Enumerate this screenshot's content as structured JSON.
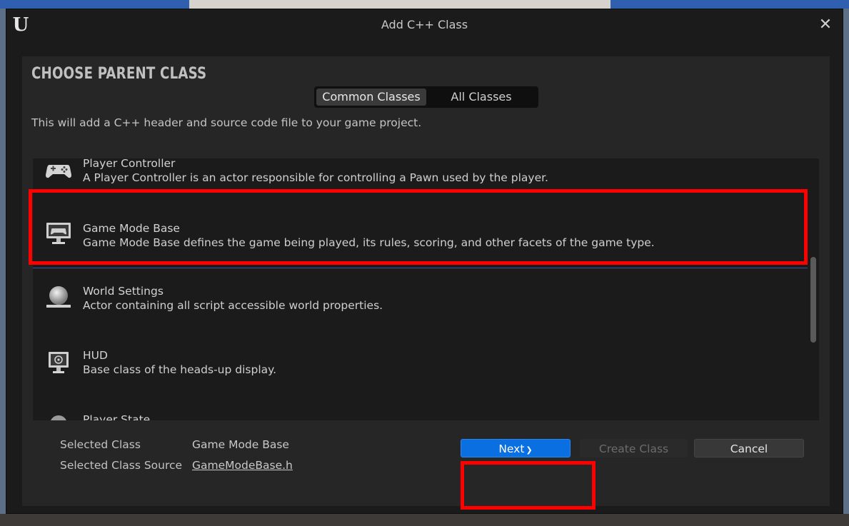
{
  "dialog": {
    "title": "Add C++ Class",
    "logo_text": "U",
    "close_glyph": "✕"
  },
  "panel": {
    "heading": "CHOOSE PARENT CLASS",
    "tabs": [
      {
        "label": "Common Classes",
        "active": true
      },
      {
        "label": "All Classes",
        "active": false
      }
    ],
    "description": "This will add a C++ header and source code file to your game project."
  },
  "class_list": {
    "items": [
      {
        "name": "Player Controller",
        "description": "A Player Controller is an actor responsible for controlling a Pawn used by the player.",
        "icon": "gamepad-icon"
      },
      {
        "name": "Game Mode Base",
        "description": "Game Mode Base defines the game being played, its rules, scoring, and other facets of the game type.",
        "icon": "monitor-gamepad-icon",
        "selected": true
      },
      {
        "name": "World Settings",
        "description": "Actor containing all script accessible world properties.",
        "icon": "sphere-icon"
      },
      {
        "name": "HUD",
        "description": "Base class of the heads-up display.",
        "icon": "monitor-target-icon"
      },
      {
        "name": "Player State",
        "description": "",
        "icon": "sphere-icon"
      }
    ]
  },
  "selection": {
    "class_label": "Selected Class",
    "class_value": "Game Mode Base",
    "source_label": "Selected Class Source",
    "source_value": "GameModeBase.h"
  },
  "buttons": {
    "next": "Next",
    "next_glyph": "❯",
    "create": "Create Class",
    "cancel": "Cancel"
  },
  "colors": {
    "primary_button": "#0a6fe0",
    "highlight": "#ff0000",
    "selection_underline": "#3a53a0"
  }
}
